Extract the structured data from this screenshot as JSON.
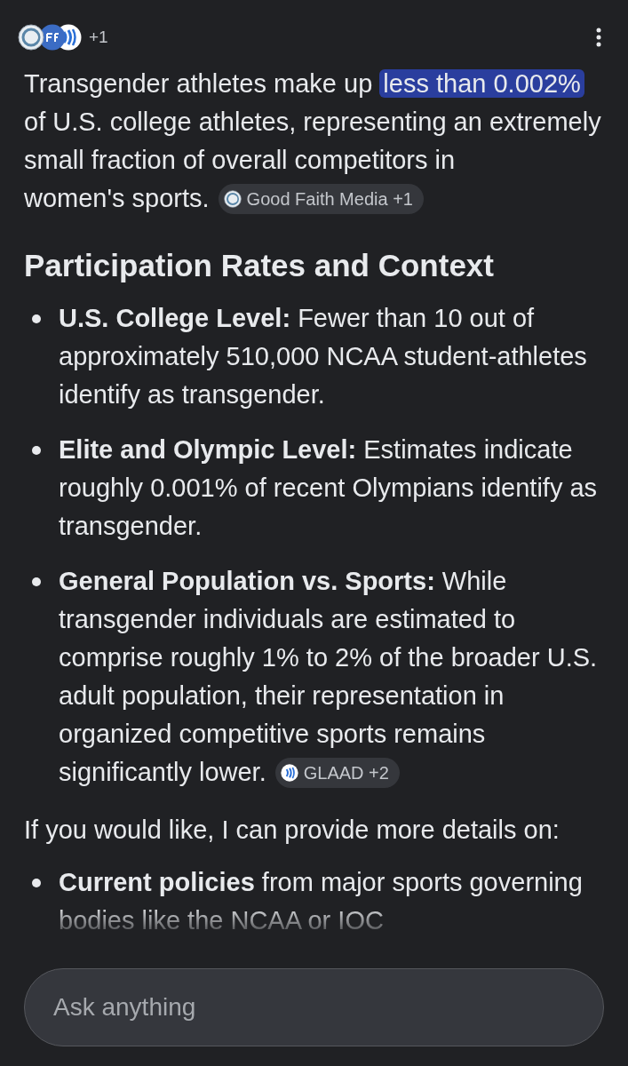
{
  "header": {
    "extra_sources": "+1"
  },
  "intro": {
    "before": "Transgender athletes make up",
    "highlight": "less than 0.002%",
    "after": "of U.S. college athletes, representing an extremely small fraction of overall competitors in",
    "tail": "women's sports.",
    "chip": {
      "label": "Good Faith Media +1"
    }
  },
  "heading": "Participation Rates and Context",
  "bullets": [
    {
      "text": "**U.S. College Level:** Fewer than 10 out of approximately 510,000 NCAA student-athletes identify as transgender."
    },
    {
      "text": "**Elite and Olympic Level:** Estimates indicate roughly 0.001% of recent Olympians identify as transgender."
    },
    {
      "text": "**General Population vs. Sports:** While transgender individuals are estimated to comprise roughly 1% to 2% of the broader U.S. adult population, their representation in organized competitive sports remains",
      "tail": "significantly lower.",
      "chip": {
        "label": "GLAAD +2"
      }
    }
  ],
  "followup": "If you would like, I can provide more details on:",
  "more_bullets": [
    {
      "text": "**Current policies** from major sports governing bodies like the NCAA or IOC"
    }
  ],
  "input": {
    "placeholder": "Ask anything"
  }
}
